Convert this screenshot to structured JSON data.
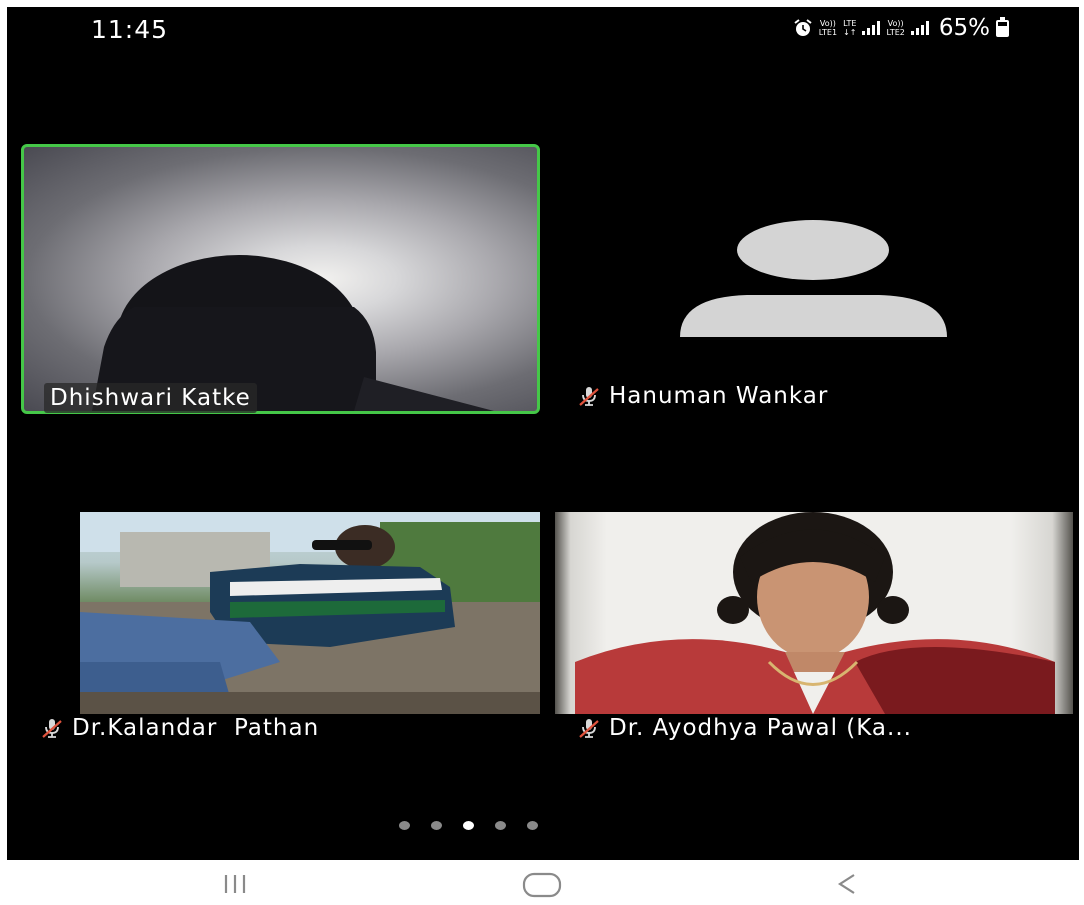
{
  "status_bar": {
    "time": "11:45",
    "sim1_label_top": "Vo))",
    "sim1_label_bottom": "LTE1",
    "lte_label_top": "LTE",
    "lte_label_bottom": "↓↑",
    "sim2_label_top": "Vo))",
    "sim2_label_bottom": "LTE2",
    "battery_percent": "65%",
    "battery_level": 0.65
  },
  "participants": [
    {
      "name": "Dhishwari Katke",
      "muted": false,
      "active_speaker": true,
      "has_video": true
    },
    {
      "name": "Hanuman Wankar",
      "muted": true,
      "active_speaker": false,
      "has_video": false
    },
    {
      "name": "Dr.Kalandar  Pathan",
      "muted": true,
      "active_speaker": false,
      "has_video": true
    },
    {
      "name": "Dr. Ayodhya Pawal (Ka...",
      "muted": true,
      "active_speaker": false,
      "has_video": true
    }
  ],
  "pager": {
    "page_count": 5,
    "active_index": 2
  },
  "nav": {
    "recents_icon": "recent-apps-icon",
    "home_icon": "home-icon",
    "back_icon": "back-icon"
  },
  "colors": {
    "active_speaker_border": "#45c748",
    "muted_icon": "#e0533d",
    "background": "#000000"
  }
}
